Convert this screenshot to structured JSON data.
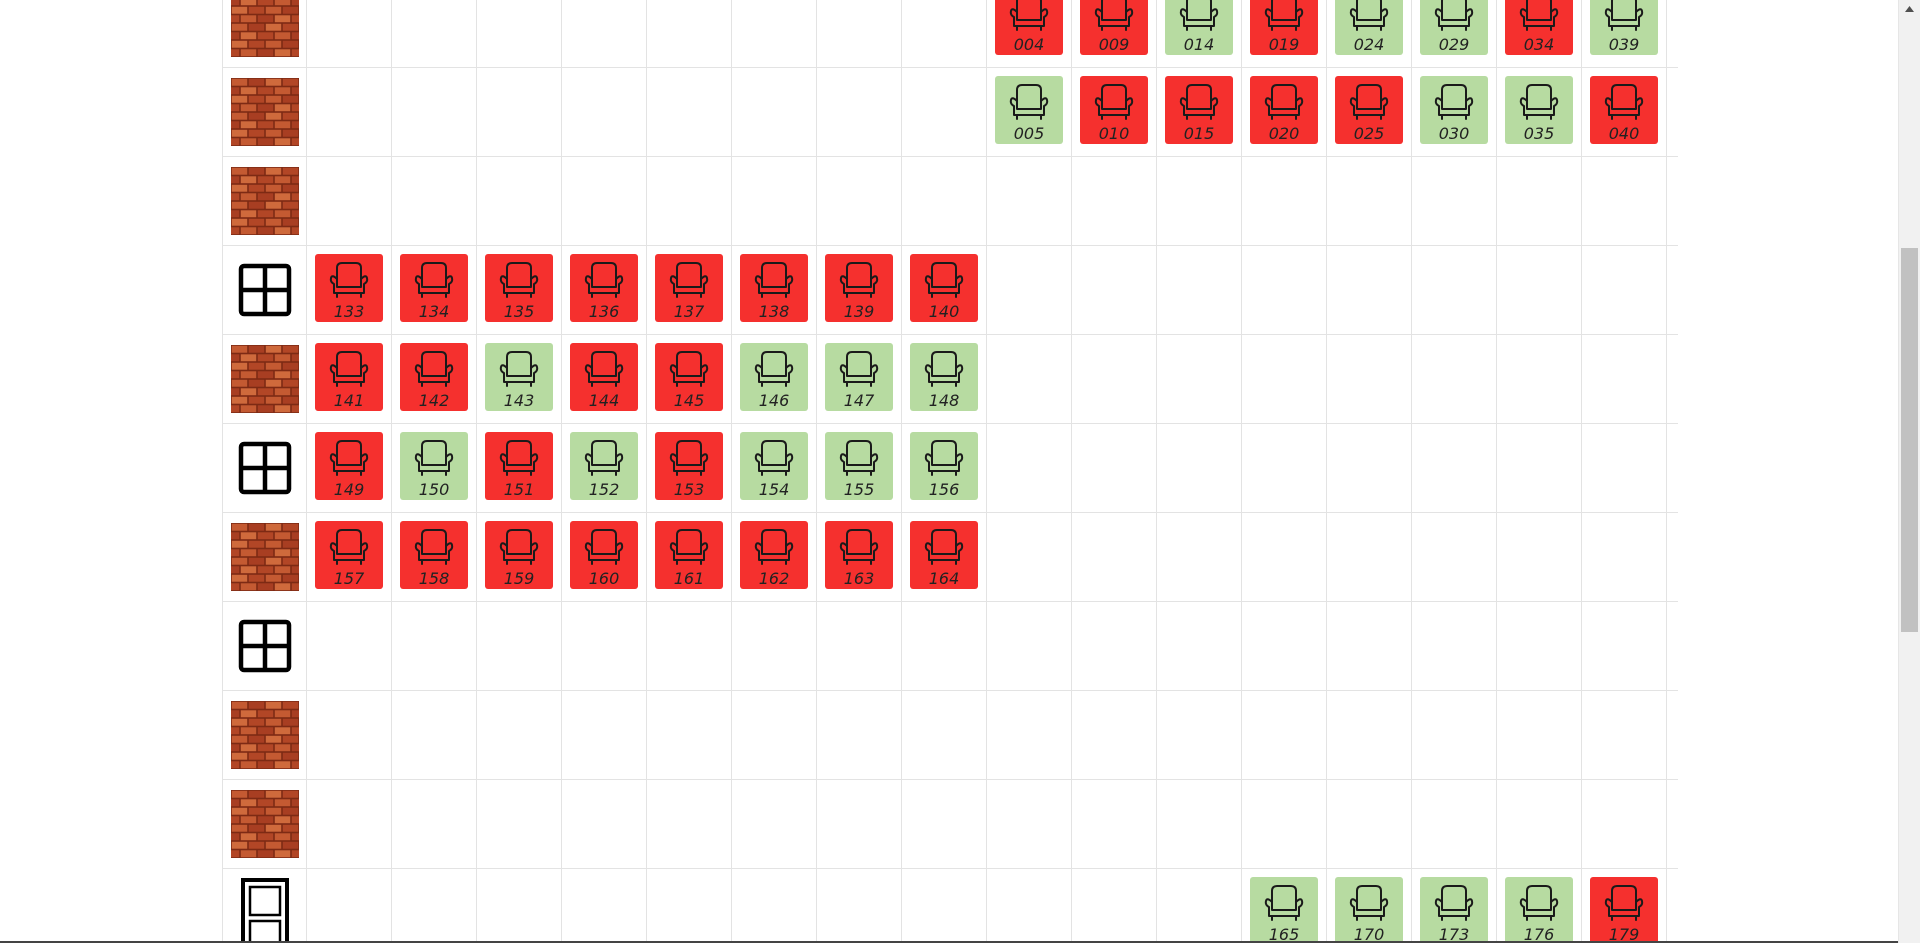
{
  "colors": {
    "taken": "#f5302e",
    "free": "#b7dba1",
    "brick": "#b5472a",
    "grid_line": "#e3e3e3"
  },
  "icons": {
    "brick": "brick-wall-icon",
    "window": "window-icon",
    "door": "door-icon",
    "seat": "armchair-icon"
  },
  "rows": [
    {
      "wall": "brick",
      "seats": [
        null,
        null,
        null,
        null,
        null,
        null,
        null,
        null,
        {
          "number": "004",
          "status": "taken"
        },
        {
          "number": "009",
          "status": "taken"
        },
        {
          "number": "014",
          "status": "free"
        },
        {
          "number": "019",
          "status": "taken"
        },
        {
          "number": "024",
          "status": "free"
        },
        {
          "number": "029",
          "status": "free"
        },
        {
          "number": "034",
          "status": "taken"
        },
        {
          "number": "039",
          "status": "free"
        }
      ]
    },
    {
      "wall": "brick",
      "seats": [
        null,
        null,
        null,
        null,
        null,
        null,
        null,
        null,
        {
          "number": "005",
          "status": "free"
        },
        {
          "number": "010",
          "status": "taken"
        },
        {
          "number": "015",
          "status": "taken"
        },
        {
          "number": "020",
          "status": "taken"
        },
        {
          "number": "025",
          "status": "taken"
        },
        {
          "number": "030",
          "status": "free"
        },
        {
          "number": "035",
          "status": "free"
        },
        {
          "number": "040",
          "status": "taken"
        }
      ]
    },
    {
      "wall": "brick",
      "seats": [
        null,
        null,
        null,
        null,
        null,
        null,
        null,
        null,
        null,
        null,
        null,
        null,
        null,
        null,
        null,
        null
      ]
    },
    {
      "wall": "window",
      "seats": [
        {
          "number": "133",
          "status": "taken"
        },
        {
          "number": "134",
          "status": "taken"
        },
        {
          "number": "135",
          "status": "taken"
        },
        {
          "number": "136",
          "status": "taken"
        },
        {
          "number": "137",
          "status": "taken"
        },
        {
          "number": "138",
          "status": "taken"
        },
        {
          "number": "139",
          "status": "taken"
        },
        {
          "number": "140",
          "status": "taken"
        },
        null,
        null,
        null,
        null,
        null,
        null,
        null,
        null
      ]
    },
    {
      "wall": "brick",
      "seats": [
        {
          "number": "141",
          "status": "taken"
        },
        {
          "number": "142",
          "status": "taken"
        },
        {
          "number": "143",
          "status": "free"
        },
        {
          "number": "144",
          "status": "taken"
        },
        {
          "number": "145",
          "status": "taken"
        },
        {
          "number": "146",
          "status": "free"
        },
        {
          "number": "147",
          "status": "free"
        },
        {
          "number": "148",
          "status": "free"
        },
        null,
        null,
        null,
        null,
        null,
        null,
        null,
        null
      ]
    },
    {
      "wall": "window",
      "seats": [
        {
          "number": "149",
          "status": "taken"
        },
        {
          "number": "150",
          "status": "free"
        },
        {
          "number": "151",
          "status": "taken"
        },
        {
          "number": "152",
          "status": "free"
        },
        {
          "number": "153",
          "status": "taken"
        },
        {
          "number": "154",
          "status": "free"
        },
        {
          "number": "155",
          "status": "free"
        },
        {
          "number": "156",
          "status": "free"
        },
        null,
        null,
        null,
        null,
        null,
        null,
        null,
        null
      ]
    },
    {
      "wall": "brick",
      "seats": [
        {
          "number": "157",
          "status": "taken"
        },
        {
          "number": "158",
          "status": "taken"
        },
        {
          "number": "159",
          "status": "taken"
        },
        {
          "number": "160",
          "status": "taken"
        },
        {
          "number": "161",
          "status": "taken"
        },
        {
          "number": "162",
          "status": "taken"
        },
        {
          "number": "163",
          "status": "taken"
        },
        {
          "number": "164",
          "status": "taken"
        },
        null,
        null,
        null,
        null,
        null,
        null,
        null,
        null
      ]
    },
    {
      "wall": "window",
      "seats": [
        null,
        null,
        null,
        null,
        null,
        null,
        null,
        null,
        null,
        null,
        null,
        null,
        null,
        null,
        null,
        null
      ]
    },
    {
      "wall": "brick",
      "seats": [
        null,
        null,
        null,
        null,
        null,
        null,
        null,
        null,
        null,
        null,
        null,
        null,
        null,
        null,
        null,
        null
      ]
    },
    {
      "wall": "brick",
      "seats": [
        null,
        null,
        null,
        null,
        null,
        null,
        null,
        null,
        null,
        null,
        null,
        null,
        null,
        null,
        null,
        null
      ]
    },
    {
      "wall": "door",
      "seats": [
        null,
        null,
        null,
        null,
        null,
        null,
        null,
        null,
        null,
        null,
        null,
        {
          "number": "165",
          "status": "free"
        },
        {
          "number": "170",
          "status": "free"
        },
        {
          "number": "173",
          "status": "free"
        },
        {
          "number": "176",
          "status": "free"
        },
        {
          "number": "179",
          "status": "taken"
        }
      ]
    }
  ]
}
